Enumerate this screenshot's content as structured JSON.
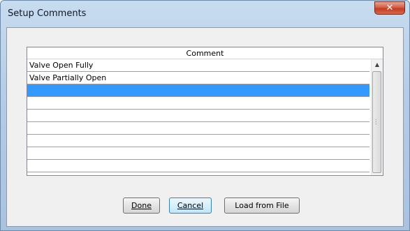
{
  "window": {
    "title": "Setup Comments",
    "close_glyph": "✕"
  },
  "grid": {
    "column_header": "Comment",
    "rows": [
      {
        "text": "Valve Open Fully",
        "selected": false
      },
      {
        "text": "Valve Partially Open",
        "selected": false
      },
      {
        "text": "",
        "selected": true
      },
      {
        "text": "",
        "selected": false
      },
      {
        "text": "",
        "selected": false
      },
      {
        "text": "",
        "selected": false
      },
      {
        "text": "",
        "selected": false
      },
      {
        "text": "",
        "selected": false
      },
      {
        "text": "",
        "selected": false
      }
    ]
  },
  "buttons": {
    "done_label": "Done",
    "cancel_label": "Cancel",
    "load_label": "Load from File"
  },
  "colors": {
    "selection": "#3399ff",
    "close_button": "#c23c22"
  }
}
